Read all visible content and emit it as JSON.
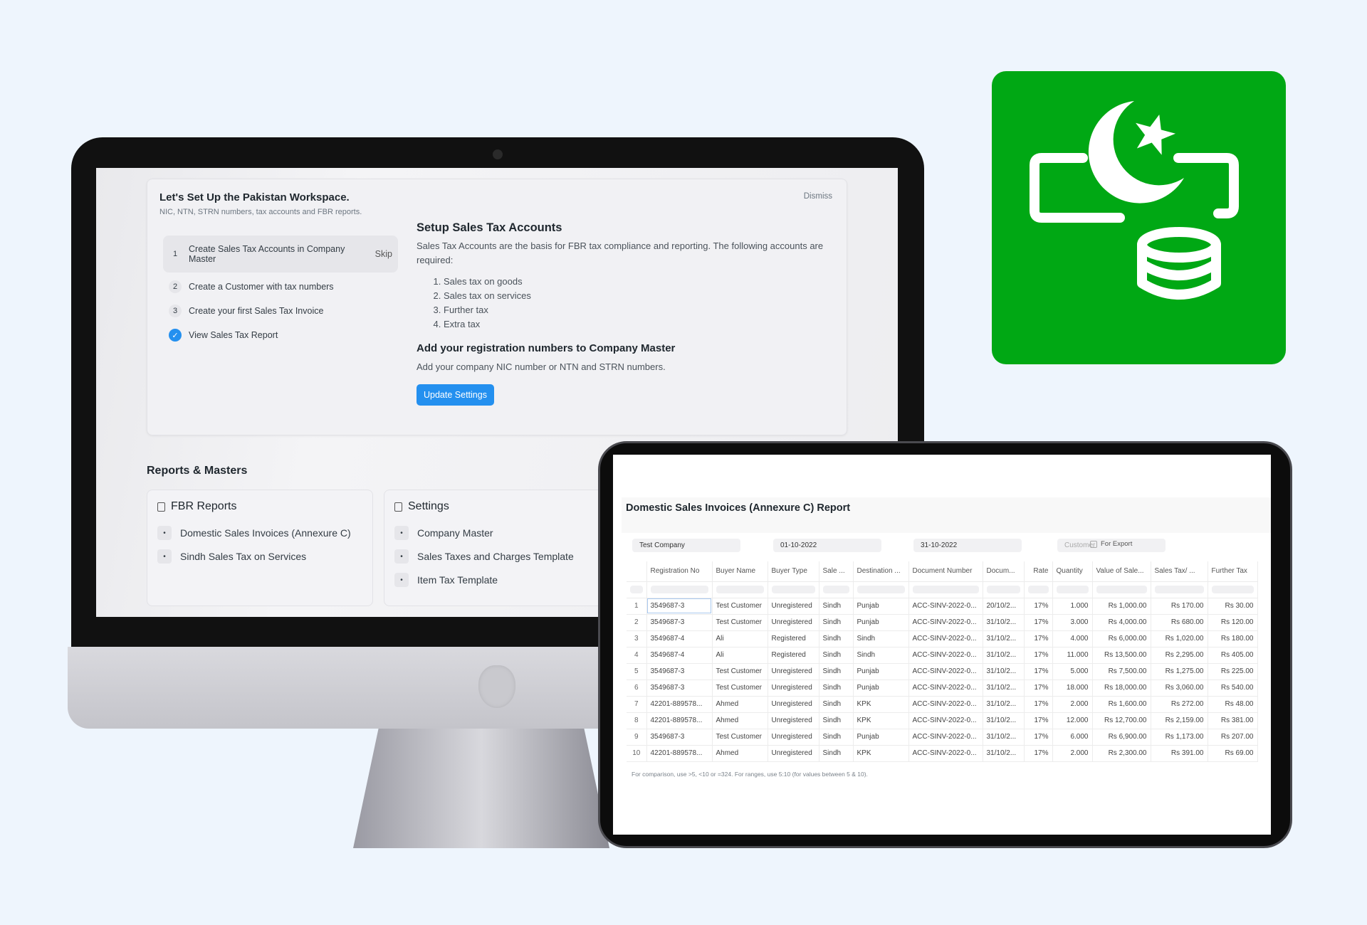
{
  "setup": {
    "title": "Let's Set Up the Pakistan Workspace.",
    "subtitle": "NIC, NTN, STRN numbers, tax accounts and FBR reports.",
    "dismiss": "Dismiss",
    "steps": [
      {
        "num": "1",
        "label": "Create Sales Tax Accounts in Company Master",
        "action": "Skip"
      },
      {
        "num": "2",
        "label": "Create a Customer with tax numbers"
      },
      {
        "num": "3",
        "label": "Create your first Sales Tax Invoice"
      },
      {
        "num": "",
        "label": "View Sales Tax Report",
        "done": true
      }
    ],
    "section1_title": "Setup Sales Tax Accounts",
    "section1_text": "Sales Tax Accounts are the basis for FBR tax compliance and reporting. The following accounts are required:",
    "accounts": [
      "Sales tax on goods",
      "Sales tax on services",
      "Further tax",
      "Extra tax"
    ],
    "section2_title": "Add your registration numbers to Company Master",
    "section2_text": "Add your company NIC number or NTN and STRN numbers.",
    "button": "Update Settings"
  },
  "reports": {
    "heading": "Reports & Masters",
    "cards": [
      {
        "title": "FBR Reports",
        "items": [
          "Domestic Sales Invoices (Annexure C)",
          "Sindh Sales Tax on Services"
        ]
      },
      {
        "title": "Settings",
        "items": [
          "Company Master",
          "Sales Taxes and Charges Template",
          "Item Tax Template"
        ]
      }
    ]
  },
  "report": {
    "title": "Domestic Sales Invoices (Annexure C) Report",
    "filters": {
      "company": "Test Company",
      "from_date": "01-10-2022",
      "to_date": "31-10-2022",
      "customer_placeholder": "Customer",
      "for_export": "For Export"
    },
    "columns": [
      "Registration No",
      "Buyer Name",
      "Buyer Type",
      "Sale ...",
      "Destination ...",
      "Document Number",
      "Docum...",
      "Rate",
      "Quantity",
      "Value of Sale...",
      "Sales Tax/ ...",
      "Further Tax"
    ],
    "rows": [
      [
        "3549687-3",
        "Test Customer",
        "Unregistered",
        "Sindh",
        "Punjab",
        "ACC-SINV-2022-0...",
        "20/10/2...",
        "17%",
        "1.000",
        "Rs 1,000.00",
        "Rs 170.00",
        "Rs 30.00"
      ],
      [
        "3549687-3",
        "Test Customer",
        "Unregistered",
        "Sindh",
        "Punjab",
        "ACC-SINV-2022-0...",
        "31/10/2...",
        "17%",
        "3.000",
        "Rs 4,000.00",
        "Rs 680.00",
        "Rs 120.00"
      ],
      [
        "3549687-4",
        "Ali",
        "Registered",
        "Sindh",
        "Sindh",
        "ACC-SINV-2022-0...",
        "31/10/2...",
        "17%",
        "4.000",
        "Rs 6,000.00",
        "Rs 1,020.00",
        "Rs 180.00"
      ],
      [
        "3549687-4",
        "Ali",
        "Registered",
        "Sindh",
        "Sindh",
        "ACC-SINV-2022-0...",
        "31/10/2...",
        "17%",
        "11.000",
        "Rs 13,500.00",
        "Rs 2,295.00",
        "Rs 405.00"
      ],
      [
        "3549687-3",
        "Test Customer",
        "Unregistered",
        "Sindh",
        "Punjab",
        "ACC-SINV-2022-0...",
        "31/10/2...",
        "17%",
        "5.000",
        "Rs 7,500.00",
        "Rs 1,275.00",
        "Rs 225.00"
      ],
      [
        "3549687-3",
        "Test Customer",
        "Unregistered",
        "Sindh",
        "Punjab",
        "ACC-SINV-2022-0...",
        "31/10/2...",
        "17%",
        "18.000",
        "Rs 18,000.00",
        "Rs 3,060.00",
        "Rs 540.00"
      ],
      [
        "42201-889578...",
        "Ahmed",
        "Unregistered",
        "Sindh",
        "KPK",
        "ACC-SINV-2022-0...",
        "31/10/2...",
        "17%",
        "2.000",
        "Rs 1,600.00",
        "Rs 272.00",
        "Rs 48.00"
      ],
      [
        "42201-889578...",
        "Ahmed",
        "Unregistered",
        "Sindh",
        "KPK",
        "ACC-SINV-2022-0...",
        "31/10/2...",
        "17%",
        "12.000",
        "Rs 12,700.00",
        "Rs 2,159.00",
        "Rs 381.00"
      ],
      [
        "3549687-3",
        "Test Customer",
        "Unregistered",
        "Sindh",
        "Punjab",
        "ACC-SINV-2022-0...",
        "31/10/2...",
        "17%",
        "6.000",
        "Rs 6,900.00",
        "Rs 1,173.00",
        "Rs 207.00"
      ],
      [
        "42201-889578...",
        "Ahmed",
        "Unregistered",
        "Sindh",
        "KPK",
        "ACC-SINV-2022-0...",
        "31/10/2...",
        "17%",
        "2.000",
        "Rs 2,300.00",
        "Rs 391.00",
        "Rs 69.00"
      ]
    ],
    "footer_note": "For comparison, use >5, <10 or =324. For ranges, use 5:10 (for values between 5 & 10)."
  },
  "colors": {
    "accent": "#2490ef",
    "brand_green": "#00a814"
  },
  "icons": {
    "app_icon": "pakistan-crescent-star-database-icon"
  }
}
